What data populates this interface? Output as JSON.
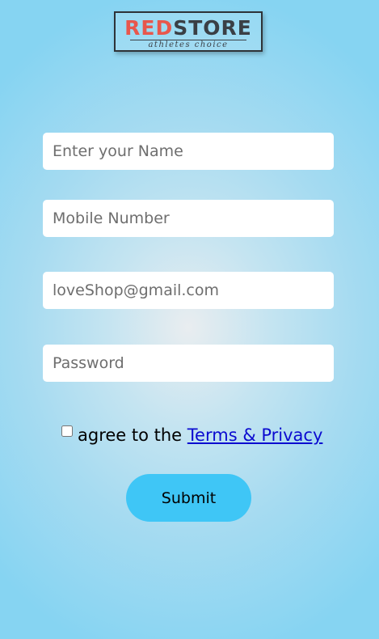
{
  "brand": {
    "logo_part1": "RED",
    "logo_part2": "STORE",
    "tagline": "athletes choice",
    "accent_color": "#e8574c",
    "dark_color": "#3a3f45"
  },
  "form": {
    "name_placeholder": "Enter your Name",
    "mobile_placeholder": "Mobile Number",
    "email_placeholder": "loveShop@gmail.com",
    "password_placeholder": "Password",
    "agree_text": "agree to the",
    "terms_link": "Terms & Privacy",
    "terms_checked": false,
    "submit_label": "Submit",
    "submit_color": "#3fc6f6"
  }
}
